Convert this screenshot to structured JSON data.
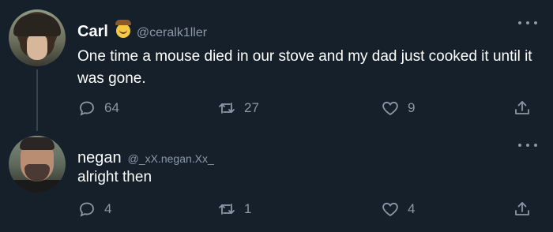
{
  "tweets": [
    {
      "name": "Carl",
      "badge_icon": "cowboy-emoji-icon",
      "handle": "@ceralk1ller",
      "text": "One time a mouse died in our stove and my dad just cooked it until it was gone.",
      "replies": "64",
      "retweets": "27",
      "likes": "9"
    },
    {
      "name": "negan",
      "handle": "@_xX.negan.Xx_",
      "text": "alright then",
      "replies": "4",
      "retweets": "1",
      "likes": "4"
    }
  ],
  "icons": [
    "reply-icon",
    "retweet-icon",
    "like-icon",
    "share-icon",
    "more-options-icon"
  ],
  "colors": {
    "background": "#15202b",
    "primary_text": "#ffffff",
    "secondary_text": "#8b98a5",
    "thread_line": "#38444d"
  }
}
